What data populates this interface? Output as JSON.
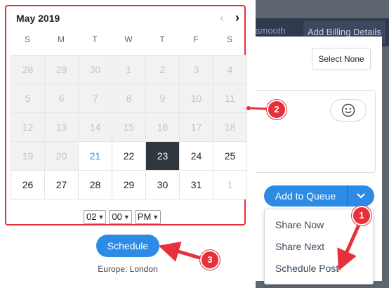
{
  "background": {
    "tabs": [
      "smooth",
      "Add Billing Details"
    ],
    "select_none_label": "Select None",
    "emoji_icon": "smiley-icon",
    "add_to_queue_label": "Add to Queue",
    "dropdown_items": [
      "Share Now",
      "Share Next",
      "Schedule Post"
    ]
  },
  "calendar": {
    "title": "May 2019",
    "weekdays": [
      "S",
      "M",
      "T",
      "W",
      "T",
      "F",
      "S"
    ],
    "days": [
      {
        "label": "28",
        "state": "disabled"
      },
      {
        "label": "29",
        "state": "disabled"
      },
      {
        "label": "30",
        "state": "disabled"
      },
      {
        "label": "1",
        "state": "disabled"
      },
      {
        "label": "2",
        "state": "disabled"
      },
      {
        "label": "3",
        "state": "disabled"
      },
      {
        "label": "4",
        "state": "disabled"
      },
      {
        "label": "5",
        "state": "disabled"
      },
      {
        "label": "6",
        "state": "disabled"
      },
      {
        "label": "7",
        "state": "disabled"
      },
      {
        "label": "8",
        "state": "disabled"
      },
      {
        "label": "9",
        "state": "disabled"
      },
      {
        "label": "10",
        "state": "disabled"
      },
      {
        "label": "11",
        "state": "disabled"
      },
      {
        "label": "12",
        "state": "disabled"
      },
      {
        "label": "13",
        "state": "disabled"
      },
      {
        "label": "14",
        "state": "disabled"
      },
      {
        "label": "15",
        "state": "disabled"
      },
      {
        "label": "16",
        "state": "disabled"
      },
      {
        "label": "17",
        "state": "disabled"
      },
      {
        "label": "18",
        "state": "disabled"
      },
      {
        "label": "19",
        "state": "disabled"
      },
      {
        "label": "20",
        "state": "disabled"
      },
      {
        "label": "21",
        "state": "today"
      },
      {
        "label": "22",
        "state": "normal"
      },
      {
        "label": "23",
        "state": "selected"
      },
      {
        "label": "24",
        "state": "normal"
      },
      {
        "label": "25",
        "state": "normal"
      },
      {
        "label": "26",
        "state": "normal"
      },
      {
        "label": "27",
        "state": "normal"
      },
      {
        "label": "28",
        "state": "normal"
      },
      {
        "label": "29",
        "state": "normal"
      },
      {
        "label": "30",
        "state": "normal"
      },
      {
        "label": "31",
        "state": "normal"
      },
      {
        "label": "1",
        "state": "next"
      }
    ],
    "hour": "02",
    "minute": "00",
    "ampm": "PM"
  },
  "schedule_label": "Schedule",
  "timezone": "Europe: London",
  "markers": [
    "1",
    "2",
    "3"
  ],
  "colors": {
    "accent": "#2b8be5",
    "annotation": "#e8303a",
    "selected_day": "#2f363d"
  }
}
